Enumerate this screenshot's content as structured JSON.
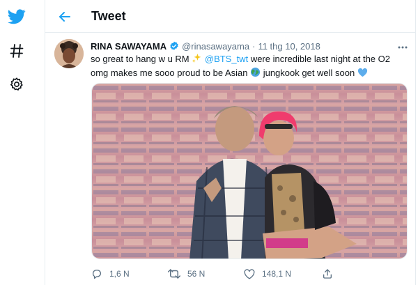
{
  "header": {
    "title": "Tweet"
  },
  "tweet": {
    "display_name": "RINA SAWAYAMA",
    "handle": "@rinasawayama",
    "separator": "·",
    "date": "11 thg 10, 2018",
    "text": {
      "line1_a": "so great to hang w u RM ",
      "mention": "@BTS_twt",
      "line1_b": " were incredible last night at the O2",
      "line2_a": "omg makes me sooo proud to be Asian ",
      "line2_b": " jungkook get well soon "
    }
  },
  "actions": {
    "reply_count": "1,6 N",
    "retweet_count": "56 N",
    "like_count": "148,1 N"
  },
  "colors": {
    "accent": "#1da1f2",
    "secondary_text": "#5b7083",
    "border": "#e6ecf0"
  },
  "icons": [
    "twitter-logo-icon",
    "hashtag-icon",
    "settings-gear-icon",
    "back-arrow-icon",
    "verified-badge-icon",
    "more-icon",
    "sparkles-emoji-icon",
    "globe-emoji-icon",
    "blue-heart-emoji-icon",
    "reply-icon",
    "retweet-icon",
    "like-icon",
    "share-icon"
  ]
}
